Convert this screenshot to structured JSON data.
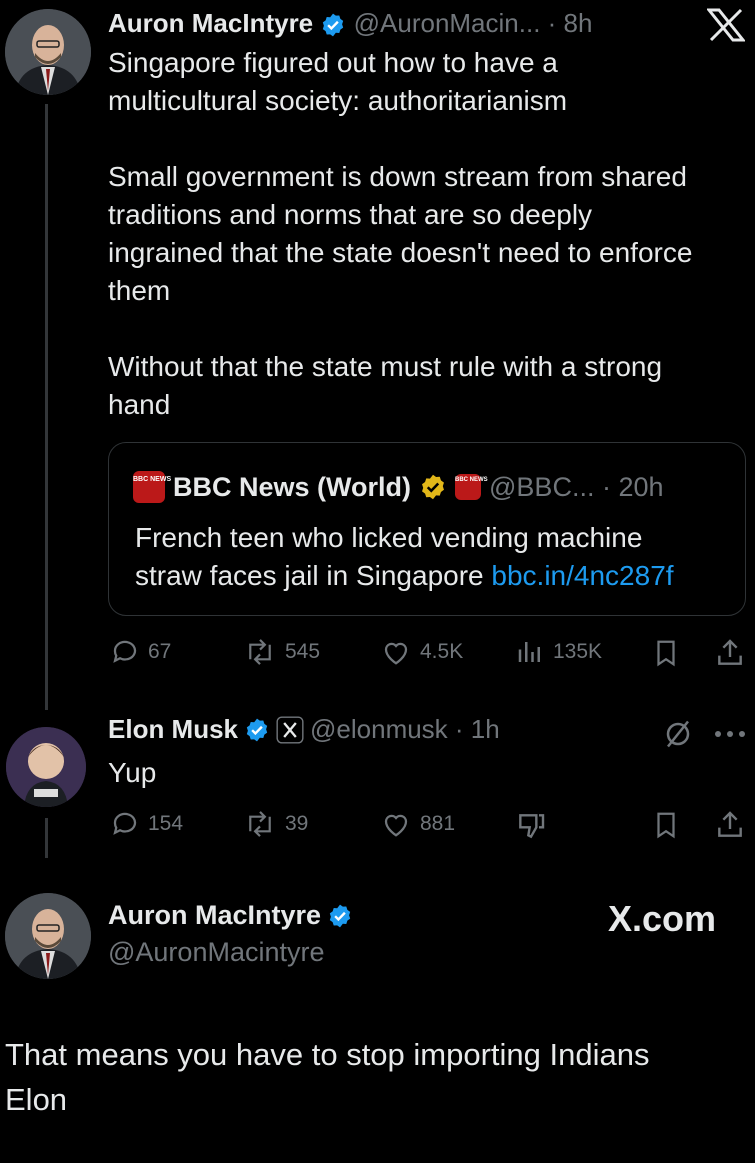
{
  "tweet1": {
    "name": "Auron MacIntyre",
    "handle_time": "@AuronMacin... · 8h",
    "text": "Singapore figured out how to have a\nmulticultural society: authoritarianism\n\nSmall government is down stream from shared\ntraditions and norms that are so deeply\ningrained that the state doesn't need to enforce\nthem\n\nWithout that the state must rule with a strong\nhand",
    "quote": {
      "name": "BBC News (World)",
      "handle_time": "@BBC... · 20h",
      "text": "French teen who licked vending machine\nstraw faces jail in Singapore ",
      "link": "bbc.in/4nc287f",
      "logo_text": "BBC NEWS"
    },
    "stats": {
      "replies": "67",
      "reposts": "545",
      "likes": "4.5K",
      "views": "135K"
    }
  },
  "tweet2": {
    "name": "Elon Musk",
    "handle_time": "@elonmusk · 1h",
    "text": "Yup",
    "stats": {
      "replies": "154",
      "reposts": "39",
      "likes": "881"
    }
  },
  "tweet3": {
    "name": "Auron MacIntyre",
    "handle": "@AuronMacintyre",
    "watermark": "X.com"
  },
  "caption": "That means you have to stop importing Indians\nElon",
  "colors": {
    "background": "#000000",
    "text": "#e7e9ea",
    "muted": "#71767b",
    "link": "#1d9bf0",
    "verified": "#1d9bf0",
    "gold": "#e2b719"
  },
  "icons": [
    "x-logo-icon",
    "verified-badge-icon",
    "reply-icon",
    "repost-icon",
    "like-icon",
    "views-icon",
    "bookmark-icon",
    "share-icon",
    "more-icon",
    "grok-icon",
    "dislike-icon"
  ]
}
